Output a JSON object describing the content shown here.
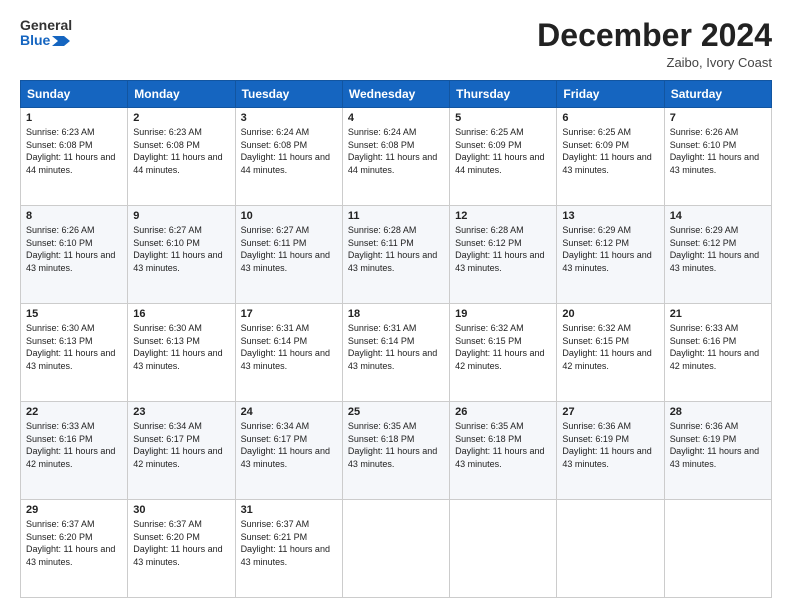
{
  "header": {
    "logo_line1": "General",
    "logo_line2": "Blue",
    "month_title": "December 2024",
    "location": "Zaibo, Ivory Coast"
  },
  "days_of_week": [
    "Sunday",
    "Monday",
    "Tuesday",
    "Wednesday",
    "Thursday",
    "Friday",
    "Saturday"
  ],
  "weeks": [
    [
      {
        "day": "1",
        "sunrise": "6:23 AM",
        "sunset": "6:08 PM",
        "daylight": "11 hours and 44 minutes."
      },
      {
        "day": "2",
        "sunrise": "6:23 AM",
        "sunset": "6:08 PM",
        "daylight": "11 hours and 44 minutes."
      },
      {
        "day": "3",
        "sunrise": "6:24 AM",
        "sunset": "6:08 PM",
        "daylight": "11 hours and 44 minutes."
      },
      {
        "day": "4",
        "sunrise": "6:24 AM",
        "sunset": "6:08 PM",
        "daylight": "11 hours and 44 minutes."
      },
      {
        "day": "5",
        "sunrise": "6:25 AM",
        "sunset": "6:09 PM",
        "daylight": "11 hours and 44 minutes."
      },
      {
        "day": "6",
        "sunrise": "6:25 AM",
        "sunset": "6:09 PM",
        "daylight": "11 hours and 43 minutes."
      },
      {
        "day": "7",
        "sunrise": "6:26 AM",
        "sunset": "6:10 PM",
        "daylight": "11 hours and 43 minutes."
      }
    ],
    [
      {
        "day": "8",
        "sunrise": "6:26 AM",
        "sunset": "6:10 PM",
        "daylight": "11 hours and 43 minutes."
      },
      {
        "day": "9",
        "sunrise": "6:27 AM",
        "sunset": "6:10 PM",
        "daylight": "11 hours and 43 minutes."
      },
      {
        "day": "10",
        "sunrise": "6:27 AM",
        "sunset": "6:11 PM",
        "daylight": "11 hours and 43 minutes."
      },
      {
        "day": "11",
        "sunrise": "6:28 AM",
        "sunset": "6:11 PM",
        "daylight": "11 hours and 43 minutes."
      },
      {
        "day": "12",
        "sunrise": "6:28 AM",
        "sunset": "6:12 PM",
        "daylight": "11 hours and 43 minutes."
      },
      {
        "day": "13",
        "sunrise": "6:29 AM",
        "sunset": "6:12 PM",
        "daylight": "11 hours and 43 minutes."
      },
      {
        "day": "14",
        "sunrise": "6:29 AM",
        "sunset": "6:12 PM",
        "daylight": "11 hours and 43 minutes."
      }
    ],
    [
      {
        "day": "15",
        "sunrise": "6:30 AM",
        "sunset": "6:13 PM",
        "daylight": "11 hours and 43 minutes."
      },
      {
        "day": "16",
        "sunrise": "6:30 AM",
        "sunset": "6:13 PM",
        "daylight": "11 hours and 43 minutes."
      },
      {
        "day": "17",
        "sunrise": "6:31 AM",
        "sunset": "6:14 PM",
        "daylight": "11 hours and 43 minutes."
      },
      {
        "day": "18",
        "sunrise": "6:31 AM",
        "sunset": "6:14 PM",
        "daylight": "11 hours and 43 minutes."
      },
      {
        "day": "19",
        "sunrise": "6:32 AM",
        "sunset": "6:15 PM",
        "daylight": "11 hours and 42 minutes."
      },
      {
        "day": "20",
        "sunrise": "6:32 AM",
        "sunset": "6:15 PM",
        "daylight": "11 hours and 42 minutes."
      },
      {
        "day": "21",
        "sunrise": "6:33 AM",
        "sunset": "6:16 PM",
        "daylight": "11 hours and 42 minutes."
      }
    ],
    [
      {
        "day": "22",
        "sunrise": "6:33 AM",
        "sunset": "6:16 PM",
        "daylight": "11 hours and 42 minutes."
      },
      {
        "day": "23",
        "sunrise": "6:34 AM",
        "sunset": "6:17 PM",
        "daylight": "11 hours and 42 minutes."
      },
      {
        "day": "24",
        "sunrise": "6:34 AM",
        "sunset": "6:17 PM",
        "daylight": "11 hours and 43 minutes."
      },
      {
        "day": "25",
        "sunrise": "6:35 AM",
        "sunset": "6:18 PM",
        "daylight": "11 hours and 43 minutes."
      },
      {
        "day": "26",
        "sunrise": "6:35 AM",
        "sunset": "6:18 PM",
        "daylight": "11 hours and 43 minutes."
      },
      {
        "day": "27",
        "sunrise": "6:36 AM",
        "sunset": "6:19 PM",
        "daylight": "11 hours and 43 minutes."
      },
      {
        "day": "28",
        "sunrise": "6:36 AM",
        "sunset": "6:19 PM",
        "daylight": "11 hours and 43 minutes."
      }
    ],
    [
      {
        "day": "29",
        "sunrise": "6:37 AM",
        "sunset": "6:20 PM",
        "daylight": "11 hours and 43 minutes."
      },
      {
        "day": "30",
        "sunrise": "6:37 AM",
        "sunset": "6:20 PM",
        "daylight": "11 hours and 43 minutes."
      },
      {
        "day": "31",
        "sunrise": "6:37 AM",
        "sunset": "6:21 PM",
        "daylight": "11 hours and 43 minutes."
      },
      null,
      null,
      null,
      null
    ]
  ]
}
